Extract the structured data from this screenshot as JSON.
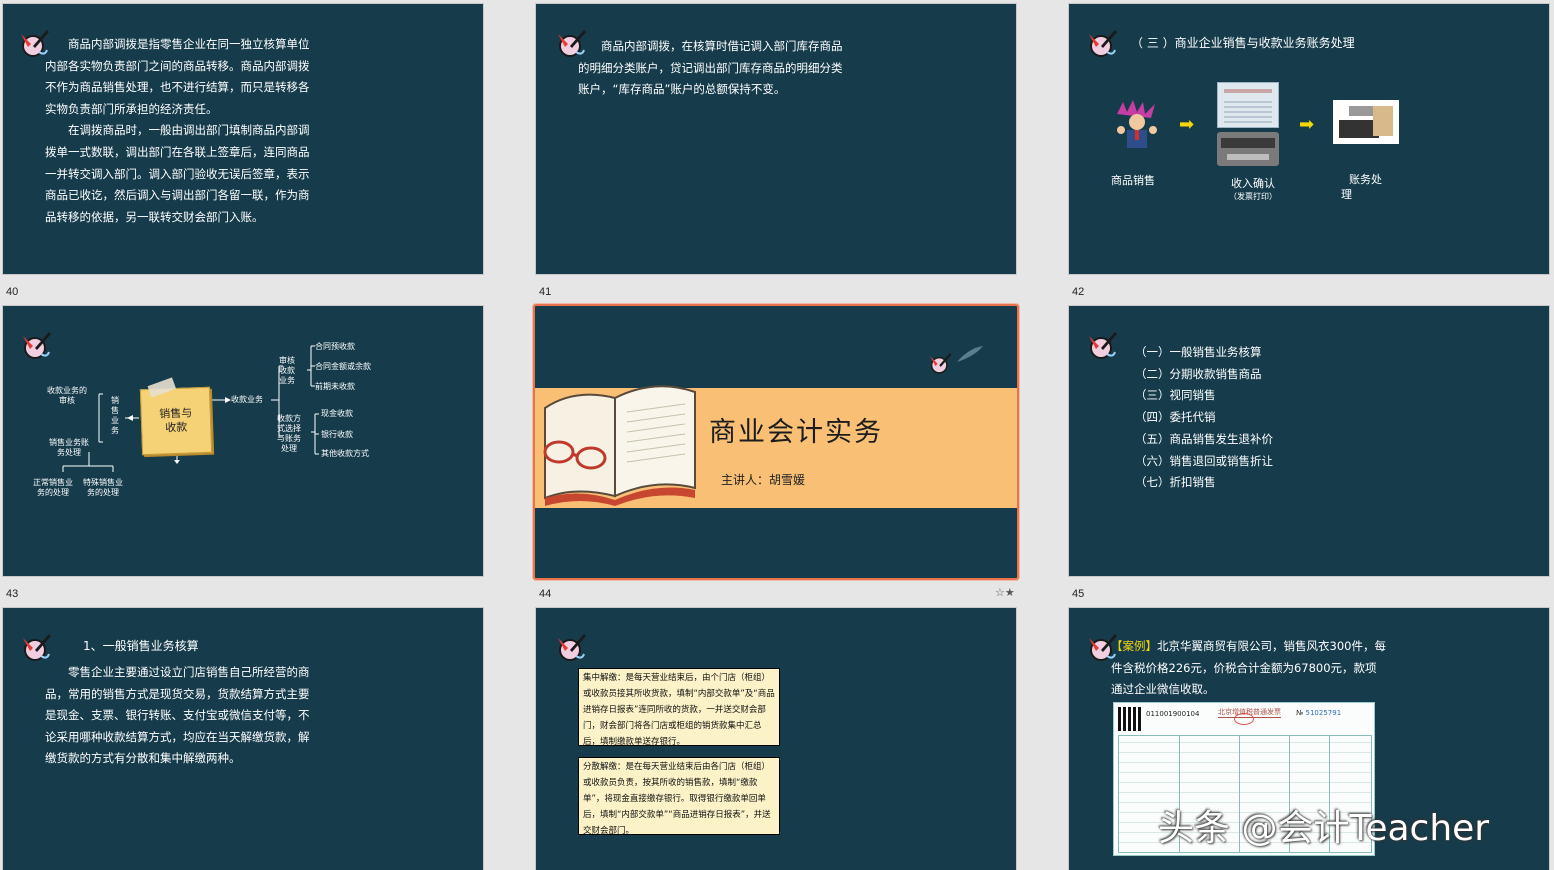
{
  "slides": [
    {
      "number": "40",
      "paragraphs": [
        "商品内部调拨是指零售企业在同一独立核算单位内部各实物负责部门之间的商品转移。商品内部调拨不作为商品销售处理，也不进行结算，而只是转移各实物负责部门所承担的经济责任。",
        "在调拨商品时，一般由调出部门填制商品内部调拨单一式数联，调出部门在各联上签章后，连同商品一并转交调入部门。调入部门验收无误后签章，表示商品已收讫，然后调入与调出部门各留一联，作为商品转移的依据，另一联转交财会部门入账。"
      ]
    },
    {
      "number": "41",
      "paragraphs": [
        "商品内部调拨，在核算时借记调入部门库存商品的明细分类账户，贷记调出部门库存商品的明细分类账户，“库存商品”账户的总额保持不变。"
      ]
    },
    {
      "number": "42",
      "heading": "（ 三 ）商业企业销售与收款业务账务处理",
      "flow": {
        "step1": "商品销售",
        "step2": "收入确认",
        "step2_sub": "（发票打印）",
        "step3_line1": "账务处",
        "step3_line2": "理"
      }
    },
    {
      "number": "43",
      "mindmap": {
        "center": [
          "销售与",
          "收款"
        ],
        "left_top": [
          "收款业务的",
          "审核"
        ],
        "left_vertical": [
          "销",
          "售",
          "业",
          "务"
        ],
        "left_bottom": [
          "销售业务账",
          "务处理"
        ],
        "bottom_left": [
          "正常销售业",
          "务的处理"
        ],
        "bottom_right": [
          "特殊销售业",
          "务的处理"
        ],
        "right_main": "收款业务",
        "review": [
          "审核",
          "收款",
          "业务"
        ],
        "review_items": [
          "合同预收款",
          "合同金额或余款",
          "前期未收款"
        ],
        "methods": [
          "收款方",
          "式选择",
          "与账务",
          "处理"
        ],
        "method_items": [
          "现金收款",
          "银行收款",
          "其他收款方式"
        ]
      }
    },
    {
      "number": "44",
      "title": "商业会计实务",
      "speaker": "主讲人：胡雪媛",
      "star": "☆★"
    },
    {
      "number": "45",
      "items": [
        "（一）一般销售业务核算",
        "（二）分期收款销售商品",
        "（三）视同销售",
        "（四）委托代销",
        "（五）商品销售发生退补价",
        "（六）销售退回或销售折让",
        "（七）折扣销售"
      ]
    },
    {
      "number": "",
      "heading": "1、一般销售业务核算",
      "paragraphs": [
        "零售企业主要通过设立门店销售自己所经营的商品，常用的销售方式是现货交易，货款结算方式主要是现金、支票、银行转账、支付宝或微信支付等，不论采用哪种收款结算方式，均应在当天解缴货款，解缴货款的方式有分散和集中解缴两种。"
      ]
    },
    {
      "number": "",
      "box1": "集中解缴：是每天营业结束后，由个门店（柜组）或收款员接其所收货款，填制“内部交款单”及“商品进销存日报表”连同所收的货款，一并送交财会部门，财会部门将各门店或柜组的销货款集中汇总后，填制缴款单送存银行。",
      "box2": "分散解缴：是在每天营业结束后由各门店（柜组）或收款员负责，按其所收的销售款，填制“缴款单”，将现金直接缴存银行。取得银行缴款单回单后，填制“内部交款单”“商品进销存日报表”，并送交财会部门。"
    },
    {
      "number": "",
      "case_label": "【案例】",
      "case_text": "北京华翼商贸有限公司，销售风衣300件，每件含税价格226元，价税合计金额为67800元，款项通过企业微信收取。",
      "invoice": {
        "code": "011001900104",
        "title": "北京增值税普通发票",
        "no_label": "№",
        "no": "51025791"
      }
    }
  ],
  "watermark": "头条 @会计Teacher",
  "colors": {
    "slide_bg": "#163c4b",
    "band": "#f8bf75",
    "selected_border": "#e8734d",
    "arrow": "#f5d70a",
    "case_label": "#f5d70a"
  }
}
